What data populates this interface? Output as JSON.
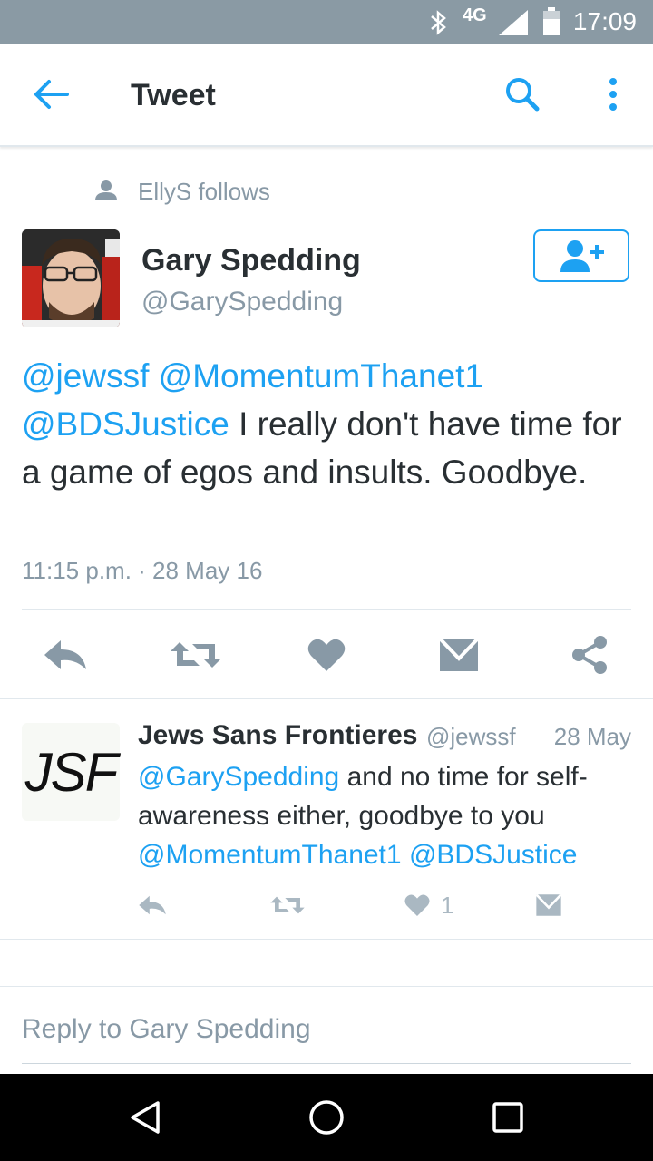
{
  "status_bar": {
    "network": "4G",
    "time": "17:09"
  },
  "app_bar": {
    "title": "Tweet"
  },
  "social_context": {
    "text": "EllyS follows"
  },
  "tweet": {
    "author_name": "Gary Spedding",
    "author_handle": "@GarySpedding",
    "mentions": [
      "@jewssf",
      "@MomentumThanet1",
      "@BDSJustice"
    ],
    "body": " I really don't have time for a game of egos and insults. Goodbye.",
    "timestamp": "11:15 p.m. · 28 May 16"
  },
  "reply": {
    "avatar_text": "JSF",
    "author_name": "Jews Sans Frontieres",
    "author_handle": "@jewssf",
    "date": "28 May",
    "mention_lead": "@GarySpedding",
    "body": " and no time for self-awareness either, goodbye to you ",
    "mention_tail_1": "@MomentumThanet1",
    "mention_tail_2": "@BDSJustice",
    "like_count": "1"
  },
  "reply_box": {
    "placeholder": "Reply to Gary Spedding"
  },
  "colors": {
    "accent": "#1da1f2",
    "status_bar": "#8a9aa4",
    "muted": "#8899a6",
    "icon_gray": "#8899a6"
  },
  "icons": {
    "back": "arrow-left-icon",
    "search": "search-icon",
    "more": "more-vertical-icon",
    "follow": "add-person-icon",
    "reply": "reply-icon",
    "retweet": "retweet-icon",
    "like": "heart-icon",
    "dm": "envelope-icon",
    "share": "share-icon"
  }
}
